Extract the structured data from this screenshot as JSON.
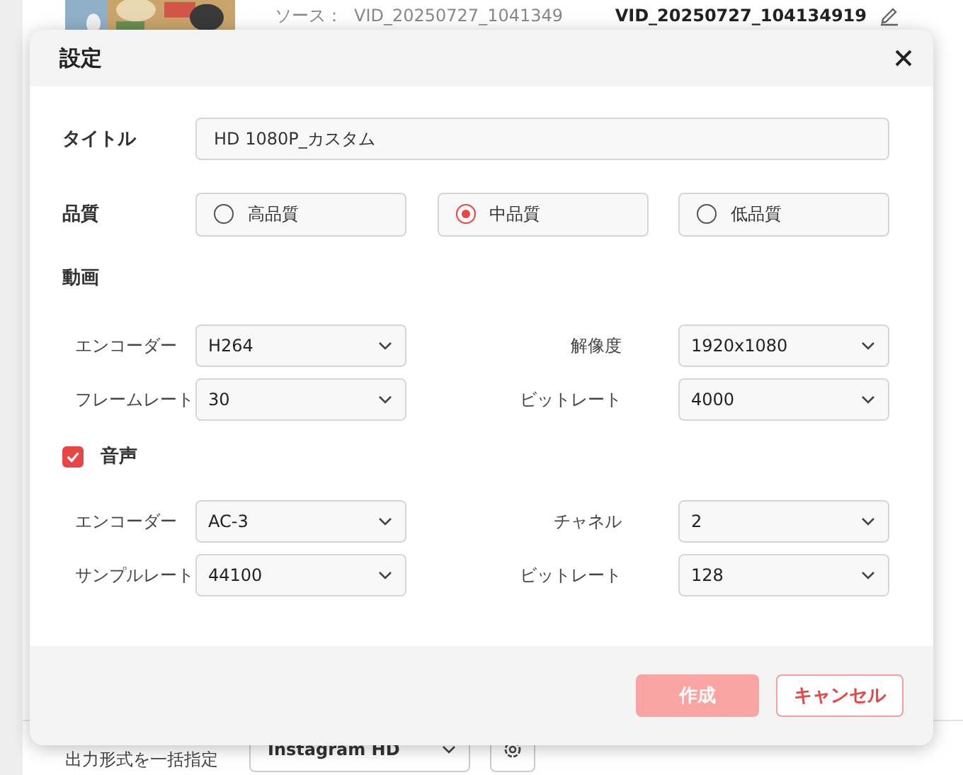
{
  "background": {
    "source_label": "ソース：",
    "source_name": "VID_20250727_1041349",
    "output_name": "VID_20250727_104134919",
    "batch_label": "出力形式を一括指定",
    "batch_format": "Instagram HD"
  },
  "dialog": {
    "title": "設定",
    "title_field": {
      "label": "タイトル",
      "value": "HD 1080P_カスタム"
    },
    "quality": {
      "label": "品質",
      "options": [
        {
          "label": "高品質",
          "selected": false
        },
        {
          "label": "中品質",
          "selected": true
        },
        {
          "label": "低品質",
          "selected": false
        }
      ]
    },
    "video": {
      "label": "動画",
      "settings": [
        {
          "label": "エンコーダー",
          "value": "H264"
        },
        {
          "label": "解像度",
          "value": "1920x1080"
        },
        {
          "label": "フレームレート",
          "value": "30"
        },
        {
          "label": "ビットレート",
          "value": "4000"
        }
      ]
    },
    "audio": {
      "label": "音声",
      "checked": true,
      "settings": [
        {
          "label": "エンコーダー",
          "value": "AC-3"
        },
        {
          "label": "チャネル",
          "value": "2"
        },
        {
          "label": "サンプルレート",
          "value": "44100"
        },
        {
          "label": "ビットレート",
          "value": "128"
        }
      ]
    },
    "buttons": [
      {
        "label": "作成",
        "kind": "primary",
        "disabled": true
      },
      {
        "label": "キャンセル",
        "kind": "secondary",
        "disabled": false
      }
    ]
  }
}
